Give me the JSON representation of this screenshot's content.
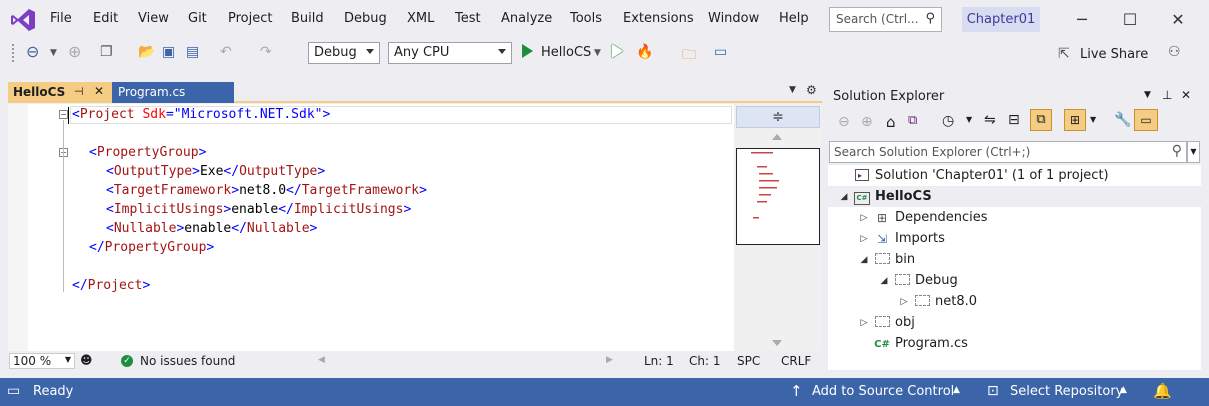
{
  "menu": [
    "File",
    "Edit",
    "View",
    "Git",
    "Project",
    "Build",
    "Debug",
    "XML",
    "Test",
    "Analyze",
    "Tools",
    "Extensions",
    "Window",
    "Help"
  ],
  "search": {
    "placeholder": "Search (Ctrl..."
  },
  "solution_badge": "Chapter01",
  "toolbar": {
    "config": "Debug",
    "platform": "Any CPU",
    "start_label": "HelloCS",
    "live_share": "Live Share"
  },
  "tabs": [
    {
      "label": "HelloCS",
      "active": true
    },
    {
      "label": "Program.cs",
      "active": false
    }
  ],
  "code": {
    "l1_open": "<",
    "l1_tag": "Project",
    "l1_attr": "Sdk",
    "l1_eq": "=\"",
    "l1_val": "Microsoft.NET.Sdk",
    "l1_close": "\">",
    "l3": "PropertyGroup",
    "l4_tag": "OutputType",
    "l4_val": "Exe",
    "l5_tag": "TargetFramework",
    "l5_val": "net8.0",
    "l6_tag": "ImplicitUsings",
    "l6_val": "enable",
    "l7_tag": "Nullable",
    "l7_val": "enable",
    "l8": "PropertyGroup",
    "l10": "Project"
  },
  "editor_status": {
    "zoom": "100 %",
    "issues": "No issues found",
    "ln": "Ln: 1",
    "ch": "Ch: 1",
    "spc": "SPC",
    "crlf": "CRLF"
  },
  "solution_explorer": {
    "title": "Solution Explorer",
    "search_placeholder": "Search Solution Explorer (Ctrl+;)",
    "tree": [
      {
        "label": "Solution 'Chapter01' (1 of 1 project)",
        "indent": 0,
        "exp": "",
        "icon": "solution-icon"
      },
      {
        "label": "HelloCS",
        "indent": 0,
        "exp": "◢",
        "icon": "csproj-icon",
        "bold": true,
        "selected": true
      },
      {
        "label": "Dependencies",
        "indent": 1,
        "exp": "▷",
        "icon": "dependencies-icon"
      },
      {
        "label": "Imports",
        "indent": 1,
        "exp": "▷",
        "icon": "imports-icon"
      },
      {
        "label": "bin",
        "indent": 1,
        "exp": "◢",
        "icon": "folder-icon"
      },
      {
        "label": "Debug",
        "indent": 2,
        "exp": "◢",
        "icon": "folder-icon"
      },
      {
        "label": "net8.0",
        "indent": 3,
        "exp": "▷",
        "icon": "folder-icon"
      },
      {
        "label": "obj",
        "indent": 1,
        "exp": "▷",
        "icon": "folder-icon"
      },
      {
        "label": "Program.cs",
        "indent": 1,
        "exp": "",
        "icon": "csharp-file-icon"
      }
    ]
  },
  "statusbar": {
    "ready": "Ready",
    "source_control": "Add to Source Control",
    "select_repo": "Select Repository"
  },
  "colors": {
    "accent": "#3c64a8",
    "active_tab": "#f5cc84",
    "vs_purple": "#68217a"
  }
}
